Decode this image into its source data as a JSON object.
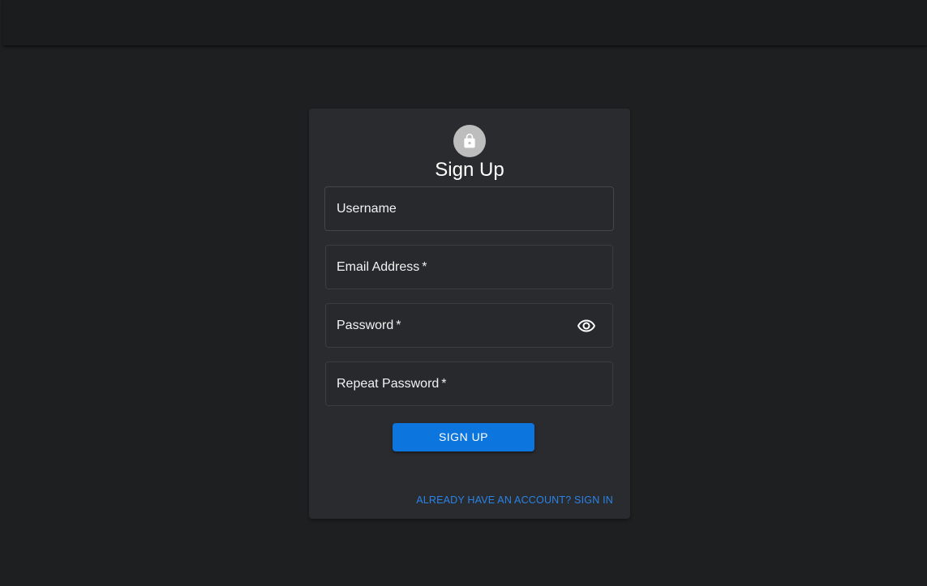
{
  "app_bar": {},
  "form": {
    "title": "Sign Up",
    "avatar_icon": "lock-icon",
    "fields": [
      {
        "label": "Username",
        "required": false,
        "value": ""
      },
      {
        "label": "Email Address",
        "required": true,
        "value": ""
      },
      {
        "label": "Password",
        "required": true,
        "value": "",
        "toggle_icon": "eye-icon"
      },
      {
        "label": "Repeat Password",
        "required": true,
        "value": ""
      }
    ],
    "required_marker": "*",
    "submit_label": "Sign Up",
    "signin_link": "Already have an account? Sign in"
  },
  "colors": {
    "background": "#1e1f21",
    "card": "#2a2b2e",
    "primary": "#0d76de",
    "link": "#2a83e6",
    "avatar": "#bdbdbd"
  }
}
